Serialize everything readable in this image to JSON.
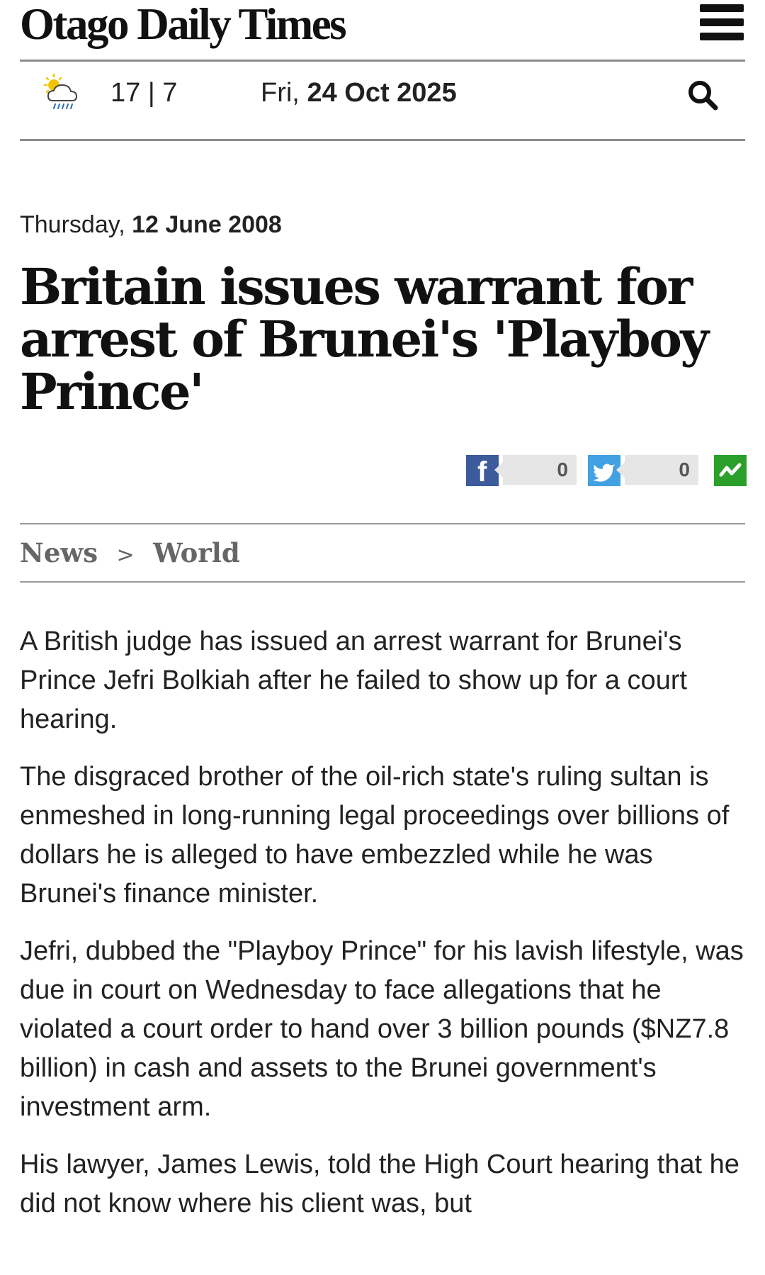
{
  "header": {
    "logo": "Otago Daily Times",
    "menu_icon": "hamburger-menu-icon"
  },
  "weather": {
    "icon": "partly-cloudy-rain-icon",
    "temps": "17 | 7"
  },
  "date_bar": {
    "weekday": "Fri,",
    "date": "24 Oct 2025",
    "search_icon": "search-icon"
  },
  "article": {
    "pub_weekday": "Thursday,",
    "pub_date": "12 June 2008",
    "headline": "Britain issues warrant for arrest of Brunei's 'Playboy Prince'",
    "share": {
      "facebook_count": "0",
      "twitter_count": "0",
      "icons": [
        "facebook-icon",
        "twitter-icon",
        "share-icon"
      ],
      "colors": {
        "facebook": "#3b5b9a",
        "twitter": "#41a1e2",
        "share": "#2aa02a"
      }
    },
    "breadcrumb": {
      "section": "News",
      "separator": ">",
      "subsection": "World"
    },
    "paragraphs": [
      "A British judge has issued an arrest warrant for Brunei's Prince Jefri Bolkiah after he failed to show up for a court hearing.",
      "The disgraced brother of the oil-rich state's ruling sultan is enmeshed in long-running legal proceedings over billions of dollars he is alleged to have embezzled while he was Brunei's finance minister.",
      "Jefri, dubbed the \"Playboy Prince\" for his lavish lifestyle, was due in court on Wednesday to face allegations that he violated a court order to hand over 3 billion pounds ($NZ7.8 billion) in cash and assets to the Brunei government's investment arm.",
      "His lawyer, James Lewis, told the High Court hearing that he did not know where his client was, but"
    ]
  }
}
